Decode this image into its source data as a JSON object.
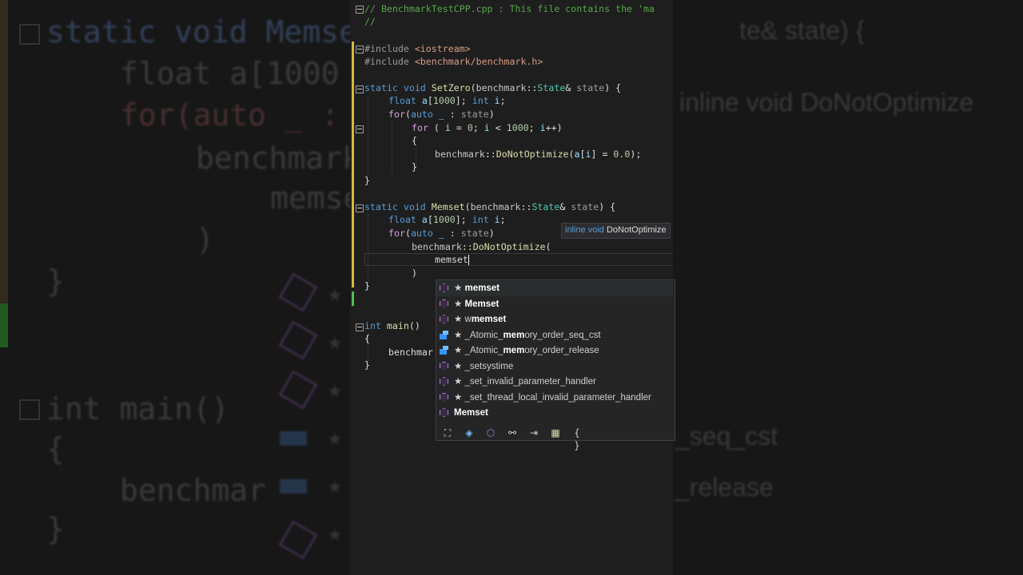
{
  "editor": {
    "lines": [
      {
        "id": "l1",
        "text": "// BenchmarkTestCPP.cpp : This file contains the 'ma"
      },
      {
        "id": "l2",
        "text": "//"
      },
      {
        "id": "l3",
        "text": "#include <iostream>"
      },
      {
        "id": "l4",
        "text": "#include <benchmark/benchmark.h>"
      },
      {
        "id": "l5",
        "text": "static void SetZero(benchmark::State& state) {"
      },
      {
        "id": "l6",
        "text": "float a[1000]; int i;"
      },
      {
        "id": "l7",
        "text": "for(auto _ : state)"
      },
      {
        "id": "l8",
        "text": "for ( i = 0; i < 1000; i++)"
      },
      {
        "id": "l9",
        "text": "{"
      },
      {
        "id": "l10",
        "text": "benchmark::DoNotOptimize(a[i] = 0.0);"
      },
      {
        "id": "l11",
        "text": "}"
      },
      {
        "id": "l12",
        "text": "}"
      },
      {
        "id": "l13",
        "text": "static void Memset(benchmark::State& state) {"
      },
      {
        "id": "l14",
        "text": "float a[1000]; int i;"
      },
      {
        "id": "l15",
        "text": "for(auto _ : state)"
      },
      {
        "id": "l16",
        "text": "benchmark::DoNotOptimize("
      },
      {
        "id": "l17",
        "text": "memset"
      },
      {
        "id": "l18",
        "text": ")"
      },
      {
        "id": "l19",
        "text": "}"
      },
      {
        "id": "l20",
        "text": "int main()"
      },
      {
        "id": "l21",
        "text": "{"
      },
      {
        "id": "l22",
        "text": "benchmar"
      },
      {
        "id": "l23",
        "text": "}"
      }
    ]
  },
  "tooltip": {
    "prefix": "inline void",
    "name": "DoNotOptimize"
  },
  "completion": {
    "items": [
      {
        "label_pre": "★ ",
        "label_match": "memset",
        "label_post": "",
        "icon": "class-icon",
        "selected": true
      },
      {
        "label_pre": "★ ",
        "label_match": "Memset",
        "label_post": "",
        "icon": "class-icon",
        "selected": false
      },
      {
        "label_pre": "★ w",
        "label_match": "memset",
        "label_post": "",
        "icon": "class-icon",
        "selected": false
      },
      {
        "label_pre": "★ _Atomic_",
        "label_match": "mem",
        "label_post": "ory_order_seq_cst",
        "icon": "enum-member-icon",
        "selected": false
      },
      {
        "label_pre": "★ _Atomic_",
        "label_match": "mem",
        "label_post": "ory_order_release",
        "icon": "enum-member-icon",
        "selected": false
      },
      {
        "label_pre": "★ _setsystime",
        "label_match": "",
        "label_post": "",
        "icon": "class-icon",
        "selected": false
      },
      {
        "label_pre": "★ _set_invalid_parameter_handler",
        "label_match": "",
        "label_post": "",
        "icon": "class-icon",
        "selected": false
      },
      {
        "label_pre": "★ _set_thread_local_invalid_parameter_handler",
        "label_match": "",
        "label_post": "",
        "icon": "class-icon",
        "selected": false
      },
      {
        "label_pre": "",
        "label_match": "Memset",
        "label_post": "",
        "icon": "class-icon",
        "selected": false
      }
    ],
    "filters": [
      {
        "icon": "macro-filter-icon",
        "glyph": "⛶",
        "color": "#cccccc"
      },
      {
        "icon": "variable-filter-icon",
        "glyph": "◈",
        "color": "#75beff"
      },
      {
        "icon": "function-filter-icon",
        "glyph": "⬡",
        "color": "#b180d7"
      },
      {
        "icon": "type-filter-icon",
        "glyph": "⚯",
        "color": "#dcdcaa"
      },
      {
        "icon": "namespace-filter-icon",
        "glyph": "⇥",
        "color": "#cccccc"
      },
      {
        "icon": "enum-filter-icon",
        "glyph": "▦",
        "color": "#dcdcaa"
      },
      {
        "icon": "braces-filter-icon",
        "glyph": "{ }",
        "color": "#cccccc"
      }
    ]
  },
  "background": {
    "lines": [
      "static void Memse",
      "float a[1000",
      "for(auto _ :",
      "benchmark",
      "memse",
      ")",
      "}",
      "int main()",
      "{",
      "benchmar",
      "}"
    ],
    "right_lines": [
      "te& state) {",
      "inline void DoNotOptimize",
      "_seq_cst",
      "_release"
    ]
  },
  "colors": {
    "editor_bg": "#1e1e1e",
    "keyword": "#569cd6",
    "type": "#4ec9b0",
    "function": "#dcdcaa",
    "string": "#d69d85",
    "comment": "#57a64a",
    "popup_bg": "#252526"
  }
}
